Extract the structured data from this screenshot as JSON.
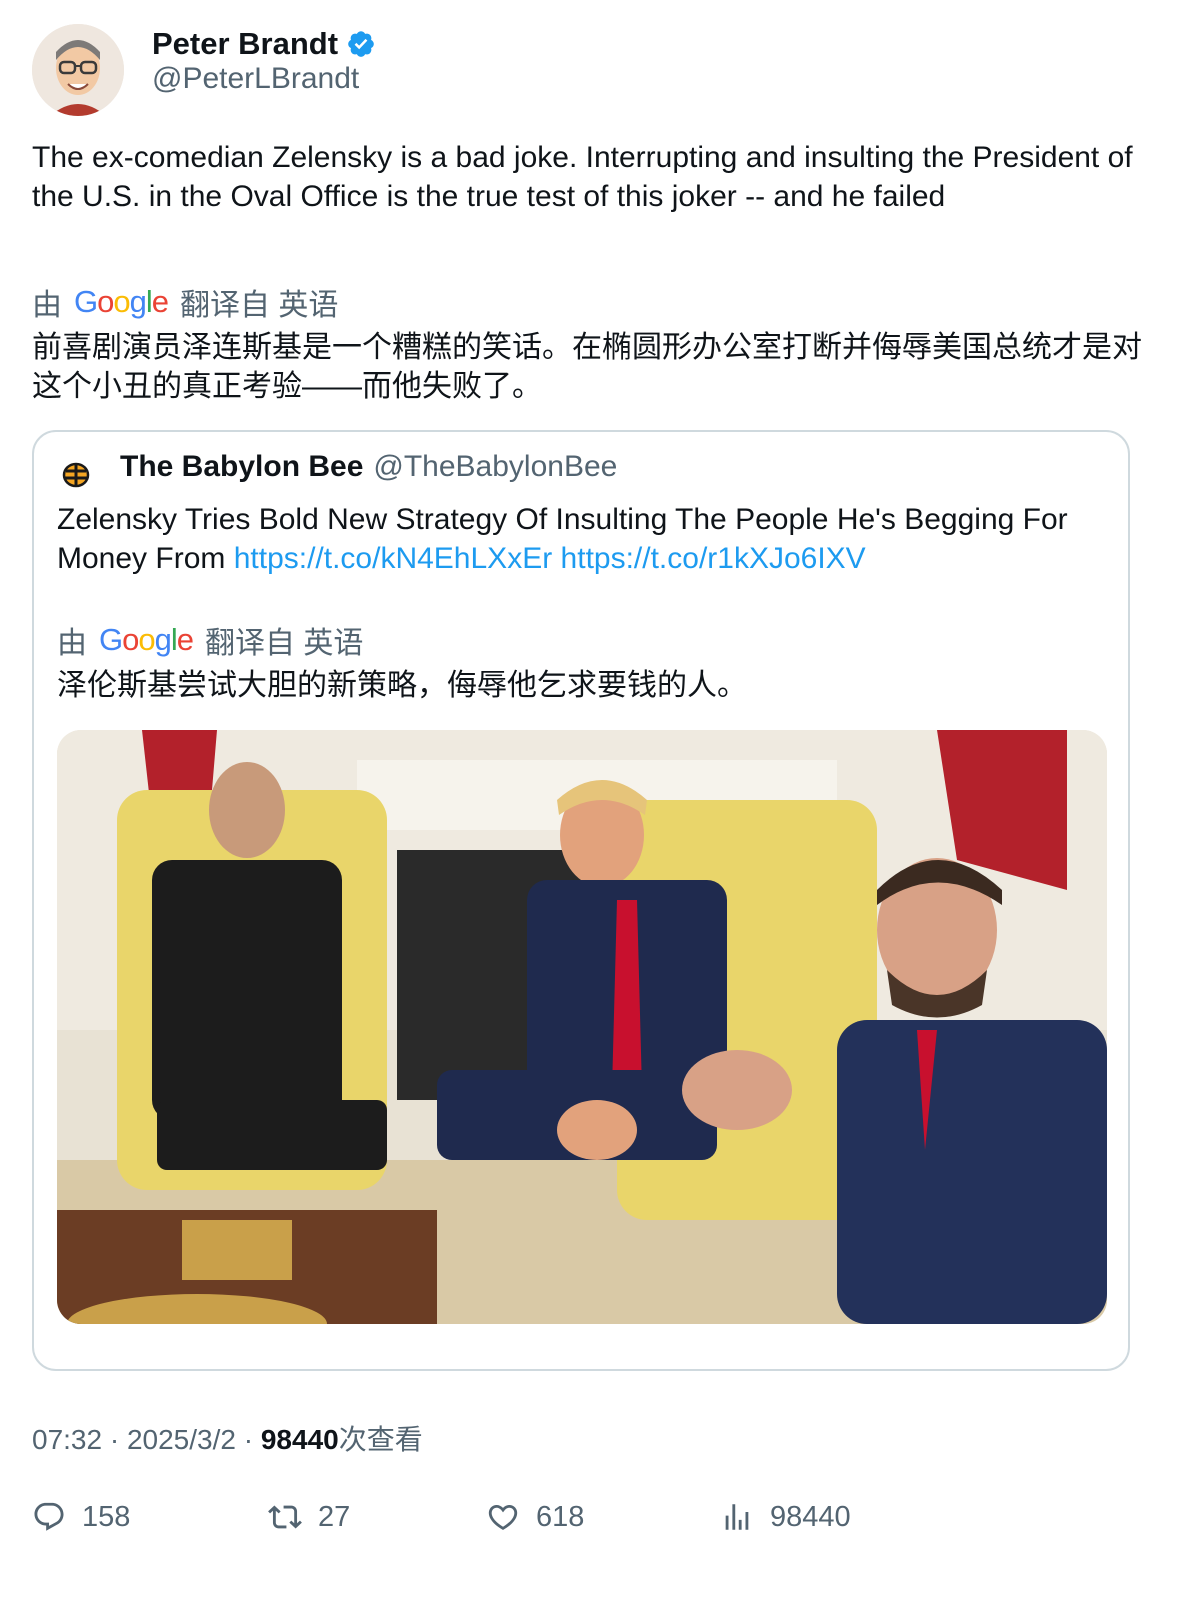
{
  "author": {
    "name": "Peter Brandt",
    "handle": "@PeterLBrandt",
    "verified_color": "#1d9bf0"
  },
  "tweet": {
    "text": "The ex-comedian Zelensky is a bad joke. Interrupting and insulting the President of the U.S. in the Oval Office is the true test of this joker -- and he failed",
    "translate": {
      "prefix": "由",
      "brand": "Google",
      "suffix": "翻译自 英语",
      "text": "前喜剧演员泽连斯基是一个糟糕的笑话。在椭圆形办公室打断并侮辱美国总统才是对这个小丑的真正考验——而他失败了。"
    }
  },
  "quote": {
    "name": "The Babylon Bee",
    "handle": "@TheBabylonBee",
    "text": "Zelensky Tries Bold New Strategy Of Insulting The People He's Begging For Money From ",
    "link1": "https://t.co/kN4EhLXxEr",
    "link2": "https://t.co/r1kXJo6IXV",
    "translate": {
      "prefix": "由",
      "brand": "Google",
      "suffix": "翻译自 英语",
      "text": "泽伦斯基尝试大胆的新策略，侮辱他乞求要钱的人。"
    },
    "media_icon": "oval-office-photo"
  },
  "meta": {
    "time": "07:32",
    "date": "2025/3/2",
    "views": "98440",
    "views_suffix": "次查看"
  },
  "actions": {
    "replies": "158",
    "retweets": "27",
    "likes": "618",
    "views": "98440"
  },
  "colors": {
    "text": "#0f1419",
    "secondary": "#536471",
    "link": "#1d9bf0",
    "border": "#cfd9de"
  }
}
